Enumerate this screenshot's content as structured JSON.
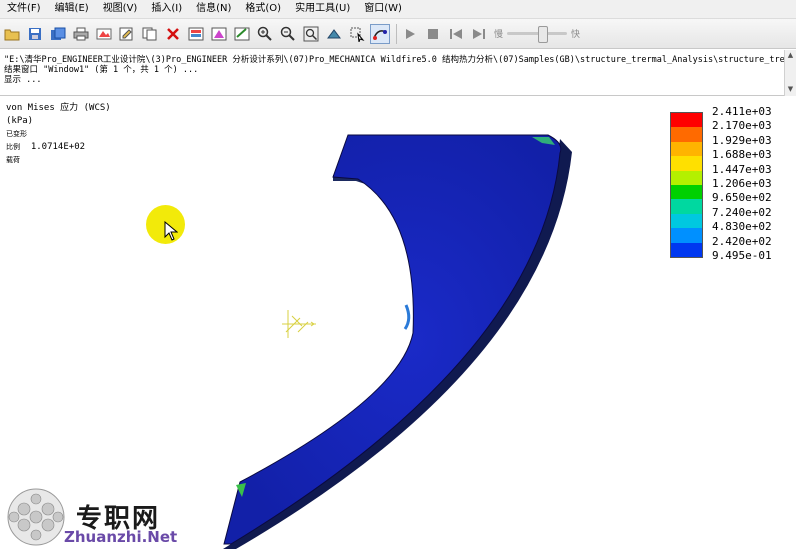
{
  "menu": [
    "文件(F)",
    "编辑(E)",
    "视图(V)",
    "插入(I)",
    "信息(N)",
    "格式(O)",
    "实用工具(U)",
    "窗口(W)"
  ],
  "toolbar": {
    "icons": [
      "open-folder-icon",
      "save-icon",
      "save-copy-icon",
      "print-icon",
      "repaint-icon",
      "edit-icon",
      "copy-icon",
      "delete-icon",
      "display-icon",
      "shade-icon",
      "edit-definition-icon",
      "zoom-in-icon",
      "zoom-out-icon",
      "zoom-fit-icon",
      "orient-icon",
      "query-icon",
      "animate-icon",
      "play-icon",
      "stop-icon",
      "step-back-icon",
      "step-forward-icon"
    ],
    "slow_label": "慢",
    "fast_label": "快",
    "speed_value": 0.6
  },
  "messages": {
    "line1": "\"E:\\清华Pro_ENGINEER工业设计院\\(3)Pro_ENGINEER 分析设计系列\\(07)Pro_MECHANICA Wildfire5.0 结构热力分析\\(07)Samples(GB)\\structure_trermal_Analysis\\structure_trermal_",
    "line2": "结果窗口 \"Window1\" (第 1 个，共 1 个) ...",
    "line3": "显示 ..."
  },
  "result_info": {
    "title": "von Mises 应力 (WCS)",
    "units": "(kPa)",
    "deformed_label": "已变形",
    "scale_label": "比例",
    "scale_value": "1.0714E+02",
    "load_label": "载荷"
  },
  "legend": {
    "labels": [
      "2.411e+03",
      "2.170e+03",
      "1.929e+03",
      "1.688e+03",
      "1.447e+03",
      "1.206e+03",
      "9.650e+02",
      "7.240e+02",
      "4.830e+02",
      "2.420e+02",
      "9.495e-01"
    ],
    "colors": [
      "#ff0000",
      "#ff6a00",
      "#ffb400",
      "#ffe000",
      "#b4f000",
      "#00d000",
      "#00d8a0",
      "#00c8e0",
      "#0090ff",
      "#0038f0",
      "#0000b4"
    ]
  },
  "watermark": {
    "text": "专职网",
    "url": "Zhuanzhi.Net"
  }
}
